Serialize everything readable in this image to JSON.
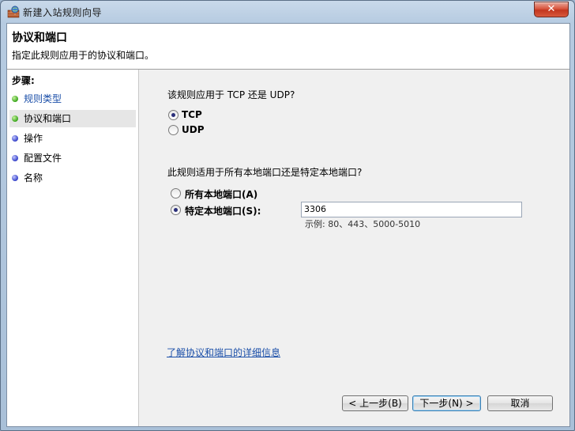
{
  "window": {
    "title": "新建入站规则向导",
    "close_label": "✕"
  },
  "header": {
    "title": "协议和端口",
    "description": "指定此规则应用于的协议和端口。"
  },
  "sidebar": {
    "steps_label": "步骤:",
    "items": [
      {
        "label": "规则类型",
        "status": "done"
      },
      {
        "label": "协议和端口",
        "status": "current"
      },
      {
        "label": "操作",
        "status": "pending"
      },
      {
        "label": "配置文件",
        "status": "pending"
      },
      {
        "label": "名称",
        "status": "pending"
      }
    ]
  },
  "protocol": {
    "question": "该规则应用于 TCP 还是 UDP?",
    "options": [
      {
        "label": "TCP",
        "checked": true
      },
      {
        "label": "UDP",
        "checked": false
      }
    ]
  },
  "ports": {
    "question": "此规则适用于所有本地端口还是特定本地端口?",
    "options": [
      {
        "label": "所有本地端口(A)",
        "checked": false
      },
      {
        "label": "特定本地端口(S):",
        "checked": true
      }
    ],
    "value": "3306",
    "example": "示例: 80、443、5000-5010"
  },
  "learn_more": "了解协议和端口的详细信息",
  "buttons": {
    "back": "< 上一步(B)",
    "next": "下一步(N) >",
    "cancel": "取消"
  },
  "colors": {
    "link": "#1a4ea8",
    "done_dot": "#37a51a",
    "pending_dot": "#3440c8"
  }
}
